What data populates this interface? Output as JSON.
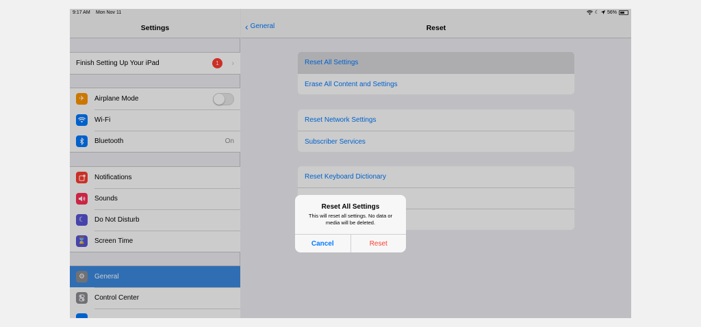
{
  "status_bar": {
    "time": "9:17 AM",
    "date": "Mon Nov 11",
    "battery": "56%",
    "battery_level": 0.56
  },
  "sidebar": {
    "title": "Settings",
    "setup": {
      "label": "Finish Setting Up Your iPad",
      "badge": "1"
    },
    "connectivity": [
      {
        "label": "Airplane Mode",
        "icon": "airplane-icon",
        "color": "#ff9500",
        "toggle": false
      },
      {
        "label": "Wi-Fi",
        "icon": "wifi-icon",
        "color": "#007aff"
      },
      {
        "label": "Bluetooth",
        "icon": "bluetooth-icon",
        "color": "#007aff",
        "value": "On"
      }
    ],
    "alerts": [
      {
        "label": "Notifications",
        "icon": "notifications-icon",
        "color": "#ff3b30"
      },
      {
        "label": "Sounds",
        "icon": "speaker-icon",
        "color": "#ff2d55"
      },
      {
        "label": "Do Not Disturb",
        "icon": "moon-icon",
        "color": "#5856d6"
      },
      {
        "label": "Screen Time",
        "icon": "hourglass-icon",
        "color": "#5856d6"
      }
    ],
    "system": [
      {
        "label": "General",
        "icon": "gear-icon",
        "color": "#8e8e93",
        "selected": true
      },
      {
        "label": "Control Center",
        "icon": "switches-icon",
        "color": "#8e8e93"
      }
    ]
  },
  "detail": {
    "back_label": "General",
    "title": "Reset",
    "group1": [
      "Reset All Settings",
      "Erase All Content and Settings"
    ],
    "group2": [
      "Reset Network Settings",
      "Subscriber Services"
    ],
    "group3": [
      "Reset Keyboard Dictionary"
    ]
  },
  "alert": {
    "title": "Reset All Settings",
    "message": "This will reset all settings. No data or media will be deleted.",
    "cancel": "Cancel",
    "confirm": "Reset"
  },
  "colors": {
    "accent": "#007aff",
    "destructive": "#ff3b30",
    "selected": "#3d8ae2"
  }
}
